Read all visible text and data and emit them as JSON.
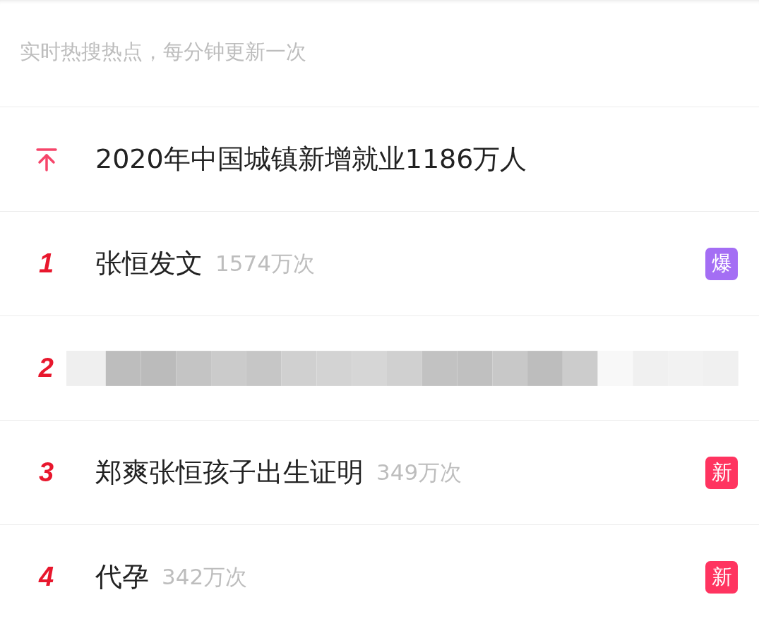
{
  "subtitle": "实时热搜热点，每分钟更新一次",
  "items": [
    {
      "kind": "pinned",
      "title": "2020年中国城镇新增就业1186万人"
    },
    {
      "kind": "ranked",
      "rank": "1",
      "title": "张恒发文",
      "count": "1574万次",
      "badge": {
        "label": "爆",
        "color": "#a46ef4"
      }
    },
    {
      "kind": "redacted",
      "rank": "2"
    },
    {
      "kind": "ranked",
      "rank": "3",
      "title": "郑爽张恒孩子出生证明",
      "count": "349万次",
      "badge": {
        "label": "新",
        "color": "#ff3460"
      }
    },
    {
      "kind": "ranked",
      "rank": "4",
      "title": "代孕",
      "count": "342万次",
      "badge": {
        "label": "新",
        "color": "#ff3460"
      }
    }
  ]
}
